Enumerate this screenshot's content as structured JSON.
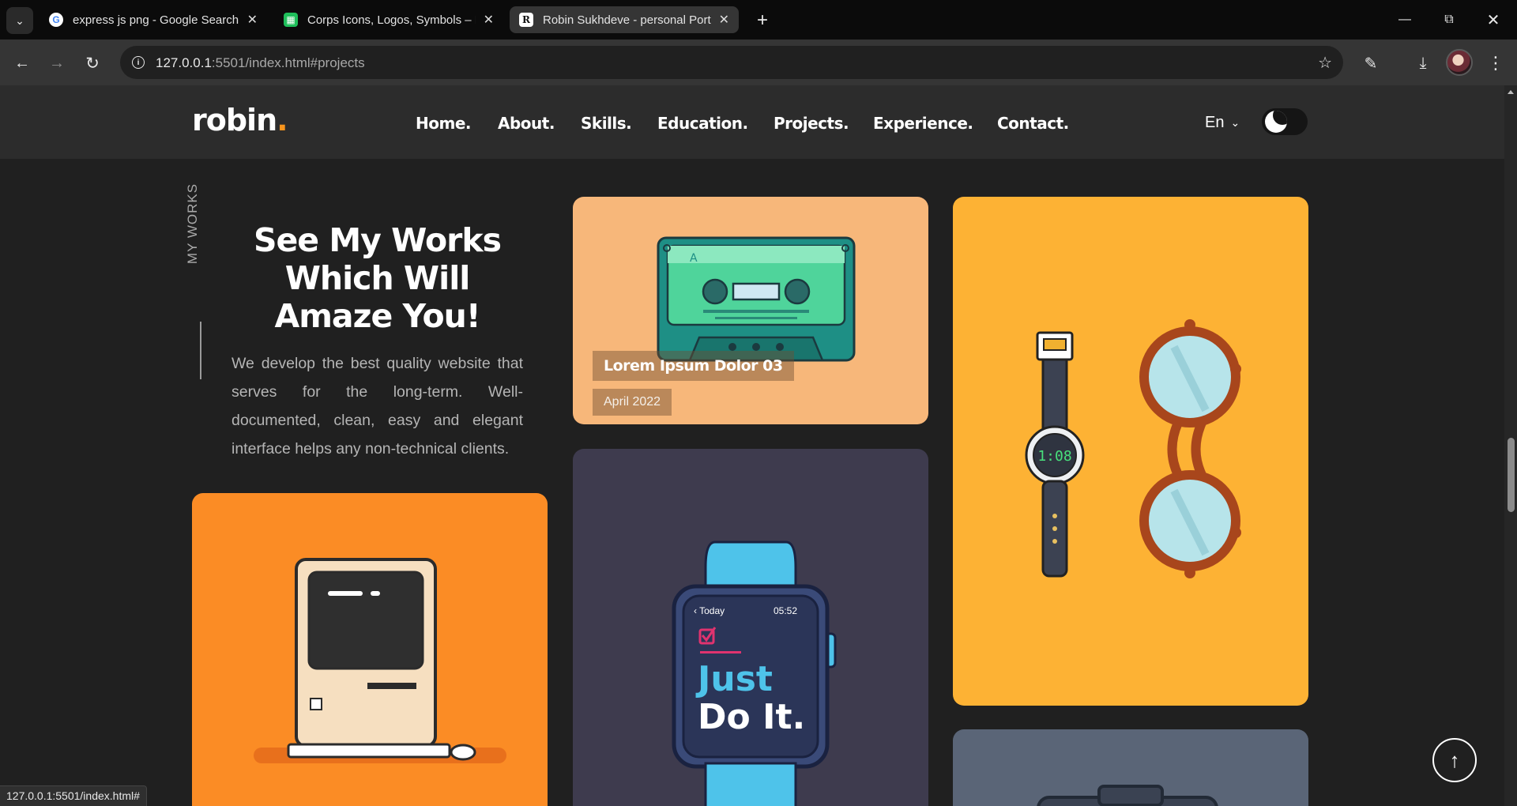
{
  "browser": {
    "tabs": [
      {
        "title": "express js png - Google Search",
        "favicon": "google-icon",
        "active": false
      },
      {
        "title": "Corps Icons, Logos, Symbols – F",
        "favicon": "iconscout-icon",
        "active": false
      },
      {
        "title": "Robin Sukhdeve - personal Port",
        "favicon": "robin-r-icon",
        "active": true
      }
    ],
    "url_host": "127.0.0.1",
    "url_rest": ":5501/index.html#projects",
    "status_url": "127.0.0.1:5501/index.html#"
  },
  "site": {
    "logo": "robin",
    "logo_dot": ".",
    "nav": [
      "Home.",
      "About.",
      "Skills.",
      "Education.",
      "Projects.",
      "Experience.",
      "Contact."
    ],
    "language": "En",
    "theme": "dark"
  },
  "section": {
    "label": "MY WORKS",
    "headline_lines": [
      "See My Works",
      "Which Will",
      "Amaze You!"
    ],
    "intro": "We develop the best quality website that serves for the long-term. Well-documented, clean, easy and elegant interface helps any non-technical clients."
  },
  "projects": [
    {
      "title": "Lorem Ipsum Dolor 03",
      "date": "April 2022",
      "illustration": "cassette-tape",
      "bg": "#f7b77a"
    },
    {
      "illustration": "retro-computer",
      "bg": "#fb8c25"
    },
    {
      "illustration": "smartwatch",
      "bg": "#3e3b4e",
      "watch_text": {
        "back": "Today",
        "time": "05:52",
        "line1": "Just",
        "line2": "Do It."
      }
    },
    {
      "illustration": "watch-and-glasses",
      "bg": "#fdb234",
      "watch_time": "1:08"
    },
    {
      "illustration": "camera",
      "bg": "#5a6577"
    }
  ],
  "colors": {
    "accent": "#f7941d",
    "page_bg": "#202020",
    "header_bg": "#2c2c2c"
  }
}
